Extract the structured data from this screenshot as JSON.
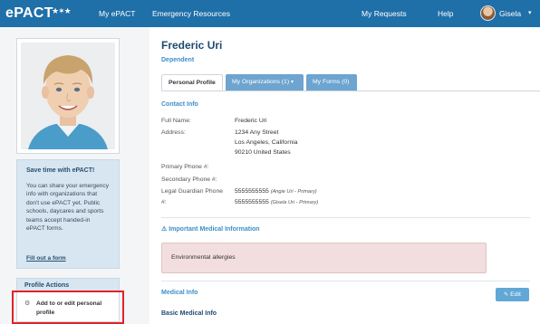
{
  "nav": {
    "logo": "ePACT",
    "logo_stars": "★✶★",
    "my_epact": "My ePACT",
    "emergency_resources": "Emergency Resources",
    "my_requests": "My Requests",
    "help": "Help",
    "user_name": "Gisela",
    "caret": "▾"
  },
  "promo": {
    "title": "Save time with ePACT!",
    "body": "You can share your emergency info with organizations that don't use ePACT yet. Public schools, daycares and sports teams accept handed-in ePACT forms.",
    "link": "Fill out a form"
  },
  "profile_actions": {
    "header": "Profile Actions",
    "gear_icon": "⚙",
    "item": "Add to or edit personal profile"
  },
  "profile": {
    "name": "Frederic Uri",
    "role": "Dependent"
  },
  "tabs": [
    {
      "label": "Personal Profile"
    },
    {
      "label": "My Organizations (1)",
      "arrow": "▾"
    },
    {
      "label": "My Forms (0)"
    }
  ],
  "contact": {
    "section": "Contact Info",
    "full_name_label": "Full Name:",
    "full_name": "Frederic Uri",
    "address_label": "Address:",
    "address_1": "1234 Any Street",
    "address_2": "Los Angeles, California",
    "address_3": "90210 United States",
    "primary_phone_label": "Primary Phone #:",
    "secondary_phone_label": "Secondary Phone #:",
    "guardian_label_1": "Legal Guardian Phone",
    "guardian_label_2": "#:",
    "guardian_1_number": "5555555555",
    "guardian_1_note": "(Angie Uri - Primary)",
    "guardian_2_number": "5555555555",
    "guardian_2_note": "(Gisela Uri - Primary)"
  },
  "medical": {
    "important_icon": "⚠",
    "important_title": "Important Medical Information",
    "important_text": "Environmental allergies",
    "section": "Medical Info",
    "edit_icon": "✎",
    "edit_label": "Edit",
    "basic_title": "Basic Medical Info"
  }
}
